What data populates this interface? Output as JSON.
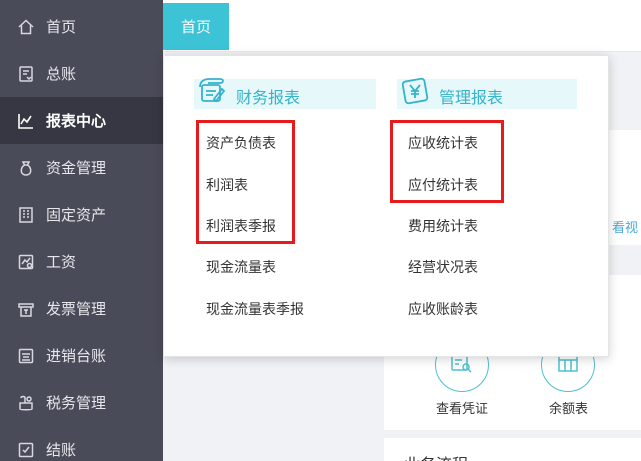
{
  "sidebar": {
    "items": [
      {
        "label": "首页",
        "icon": "home-icon"
      },
      {
        "label": "总账",
        "icon": "ledger-icon"
      },
      {
        "label": "报表中心",
        "icon": "chart-icon",
        "active": true
      },
      {
        "label": "资金管理",
        "icon": "money-bag-icon"
      },
      {
        "label": "固定资产",
        "icon": "building-icon"
      },
      {
        "label": "工资",
        "icon": "salary-icon"
      },
      {
        "label": "发票管理",
        "icon": "invoice-icon"
      },
      {
        "label": "进销台账",
        "icon": "inventory-icon"
      },
      {
        "label": "税务管理",
        "icon": "tax-icon"
      },
      {
        "label": "结账",
        "icon": "checkout-icon"
      }
    ]
  },
  "header": {
    "home_tab": "首页"
  },
  "dropdown": {
    "financial": {
      "title": "财务报表",
      "items": [
        "资产负债表",
        "利润表",
        "利润表季报",
        "现金流量表",
        "现金流量表季报"
      ]
    },
    "management": {
      "title": "管理报表",
      "items": [
        "应收统计表",
        "应付统计表",
        "费用统计表",
        "经营状况表",
        "应收账龄表"
      ]
    }
  },
  "background": {
    "peek_link": "看视",
    "shortcuts": [
      "查看凭证",
      "余额表"
    ],
    "section_title": "业务流程"
  },
  "colors": {
    "sidebar_bg": "#4a4b58",
    "sidebar_active": "#363742",
    "accent": "#3cc3d5",
    "highlight": "#e61c1c"
  }
}
